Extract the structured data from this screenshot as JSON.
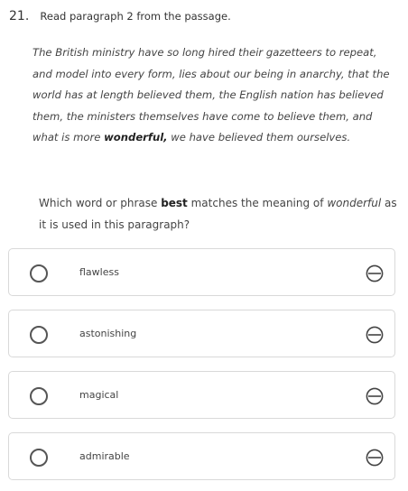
{
  "question": {
    "number": "21.",
    "instruction": "Read paragraph 2 from the passage."
  },
  "passage": {
    "text_before": "The British ministry have so long hired their gazetteers to repeat, and model into every form, lies about our being in anarchy, that the world has at length believed them, the English nation has believed them, the ministers themselves have come to believe them, and what is more ",
    "bold_word": "wonderful,",
    "text_after": " we have believed them ourselves."
  },
  "stem": {
    "part1": "Which word or phrase ",
    "bold": "best",
    "part2": " matches the meaning of ",
    "italic": "wonderful",
    "part3": " as it is used in this paragraph?"
  },
  "options": [
    {
      "label": "flawless",
      "selected": false
    },
    {
      "label": "astonishing",
      "selected": false
    },
    {
      "label": "magical",
      "selected": false
    },
    {
      "label": "admirable",
      "selected": false
    }
  ],
  "icons": {
    "radio": "radio-button-icon",
    "strike": "strikethrough-eliminate-icon"
  }
}
